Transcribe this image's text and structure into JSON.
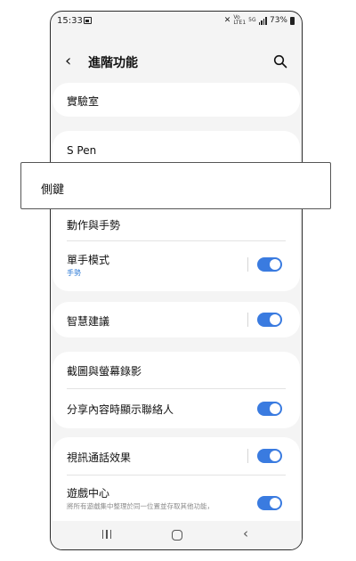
{
  "status_bar": {
    "time": "15:33",
    "network_small_top": "Vo",
    "network_small_bottom": "LTE1",
    "network_5g": "5G",
    "battery": "73%"
  },
  "header": {
    "title": "進階功能"
  },
  "items": {
    "lab": "實驗室",
    "spen": "S Pen",
    "motions": "動作與手勢",
    "one_handed": {
      "label": "單手模式",
      "sub": "手勢"
    },
    "smart_suggestions": "智慧建議",
    "screenshots": "截圖與螢幕錄影",
    "share_contacts": "分享內容時顯示聯絡人",
    "video_call": "視訊通話效果",
    "game_center": {
      "label": "遊戲中心",
      "desc": "將所有遊戲集中整理於同一位置並存取其他功能，"
    }
  },
  "popup": {
    "text": "側鍵"
  },
  "colors": {
    "accent": "#3a7be0",
    "background": "#f4f4f4",
    "card": "#ffffff"
  }
}
